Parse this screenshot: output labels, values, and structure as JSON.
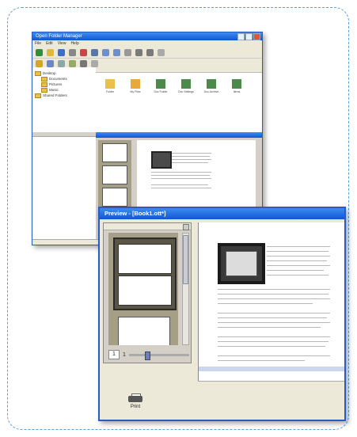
{
  "back_window": {
    "title": "Open Folder Manager",
    "menu": [
      "File",
      "Edit",
      "View",
      "Help"
    ],
    "tree": [
      {
        "label": "Desktop"
      },
      {
        "label": "Documents"
      },
      {
        "label": "Pictures"
      },
      {
        "label": "Music"
      },
      {
        "label": "Shared Folders"
      }
    ],
    "icons": [
      {
        "label": "Folder"
      },
      {
        "label": "My Files"
      },
      {
        "label": "Doc Folder"
      },
      {
        "label": "Doc Settings"
      },
      {
        "label": "Doc Archive"
      },
      {
        "label": "Items"
      }
    ]
  },
  "front_window": {
    "title": "Preview - [Book1.ott*]",
    "page_current": "1",
    "page_total": "1",
    "print_label": "Print"
  },
  "colors": {
    "title_bar": "#1454d6",
    "frame_border": "#5b9fd6",
    "window_bg": "#ece9d8"
  }
}
